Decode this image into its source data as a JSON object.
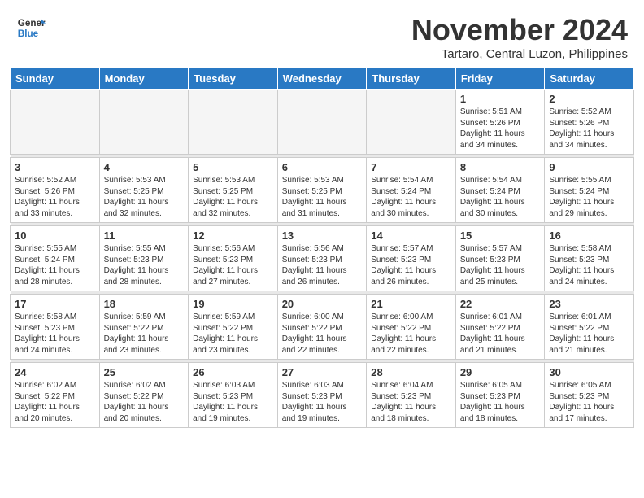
{
  "header": {
    "logo_general": "General",
    "logo_blue": "Blue",
    "month": "November 2024",
    "location": "Tartaro, Central Luzon, Philippines"
  },
  "days_of_week": [
    "Sunday",
    "Monday",
    "Tuesday",
    "Wednesday",
    "Thursday",
    "Friday",
    "Saturday"
  ],
  "weeks": [
    [
      {
        "day": "",
        "info": ""
      },
      {
        "day": "",
        "info": ""
      },
      {
        "day": "",
        "info": ""
      },
      {
        "day": "",
        "info": ""
      },
      {
        "day": "",
        "info": ""
      },
      {
        "day": "1",
        "info": "Sunrise: 5:51 AM\nSunset: 5:26 PM\nDaylight: 11 hours\nand 34 minutes."
      },
      {
        "day": "2",
        "info": "Sunrise: 5:52 AM\nSunset: 5:26 PM\nDaylight: 11 hours\nand 34 minutes."
      }
    ],
    [
      {
        "day": "3",
        "info": "Sunrise: 5:52 AM\nSunset: 5:26 PM\nDaylight: 11 hours\nand 33 minutes."
      },
      {
        "day": "4",
        "info": "Sunrise: 5:53 AM\nSunset: 5:25 PM\nDaylight: 11 hours\nand 32 minutes."
      },
      {
        "day": "5",
        "info": "Sunrise: 5:53 AM\nSunset: 5:25 PM\nDaylight: 11 hours\nand 32 minutes."
      },
      {
        "day": "6",
        "info": "Sunrise: 5:53 AM\nSunset: 5:25 PM\nDaylight: 11 hours\nand 31 minutes."
      },
      {
        "day": "7",
        "info": "Sunrise: 5:54 AM\nSunset: 5:24 PM\nDaylight: 11 hours\nand 30 minutes."
      },
      {
        "day": "8",
        "info": "Sunrise: 5:54 AM\nSunset: 5:24 PM\nDaylight: 11 hours\nand 30 minutes."
      },
      {
        "day": "9",
        "info": "Sunrise: 5:55 AM\nSunset: 5:24 PM\nDaylight: 11 hours\nand 29 minutes."
      }
    ],
    [
      {
        "day": "10",
        "info": "Sunrise: 5:55 AM\nSunset: 5:24 PM\nDaylight: 11 hours\nand 28 minutes."
      },
      {
        "day": "11",
        "info": "Sunrise: 5:55 AM\nSunset: 5:23 PM\nDaylight: 11 hours\nand 28 minutes."
      },
      {
        "day": "12",
        "info": "Sunrise: 5:56 AM\nSunset: 5:23 PM\nDaylight: 11 hours\nand 27 minutes."
      },
      {
        "day": "13",
        "info": "Sunrise: 5:56 AM\nSunset: 5:23 PM\nDaylight: 11 hours\nand 26 minutes."
      },
      {
        "day": "14",
        "info": "Sunrise: 5:57 AM\nSunset: 5:23 PM\nDaylight: 11 hours\nand 26 minutes."
      },
      {
        "day": "15",
        "info": "Sunrise: 5:57 AM\nSunset: 5:23 PM\nDaylight: 11 hours\nand 25 minutes."
      },
      {
        "day": "16",
        "info": "Sunrise: 5:58 AM\nSunset: 5:23 PM\nDaylight: 11 hours\nand 24 minutes."
      }
    ],
    [
      {
        "day": "17",
        "info": "Sunrise: 5:58 AM\nSunset: 5:23 PM\nDaylight: 11 hours\nand 24 minutes."
      },
      {
        "day": "18",
        "info": "Sunrise: 5:59 AM\nSunset: 5:22 PM\nDaylight: 11 hours\nand 23 minutes."
      },
      {
        "day": "19",
        "info": "Sunrise: 5:59 AM\nSunset: 5:22 PM\nDaylight: 11 hours\nand 23 minutes."
      },
      {
        "day": "20",
        "info": "Sunrise: 6:00 AM\nSunset: 5:22 PM\nDaylight: 11 hours\nand 22 minutes."
      },
      {
        "day": "21",
        "info": "Sunrise: 6:00 AM\nSunset: 5:22 PM\nDaylight: 11 hours\nand 22 minutes."
      },
      {
        "day": "22",
        "info": "Sunrise: 6:01 AM\nSunset: 5:22 PM\nDaylight: 11 hours\nand 21 minutes."
      },
      {
        "day": "23",
        "info": "Sunrise: 6:01 AM\nSunset: 5:22 PM\nDaylight: 11 hours\nand 21 minutes."
      }
    ],
    [
      {
        "day": "24",
        "info": "Sunrise: 6:02 AM\nSunset: 5:22 PM\nDaylight: 11 hours\nand 20 minutes."
      },
      {
        "day": "25",
        "info": "Sunrise: 6:02 AM\nSunset: 5:22 PM\nDaylight: 11 hours\nand 20 minutes."
      },
      {
        "day": "26",
        "info": "Sunrise: 6:03 AM\nSunset: 5:23 PM\nDaylight: 11 hours\nand 19 minutes."
      },
      {
        "day": "27",
        "info": "Sunrise: 6:03 AM\nSunset: 5:23 PM\nDaylight: 11 hours\nand 19 minutes."
      },
      {
        "day": "28",
        "info": "Sunrise: 6:04 AM\nSunset: 5:23 PM\nDaylight: 11 hours\nand 18 minutes."
      },
      {
        "day": "29",
        "info": "Sunrise: 6:05 AM\nSunset: 5:23 PM\nDaylight: 11 hours\nand 18 minutes."
      },
      {
        "day": "30",
        "info": "Sunrise: 6:05 AM\nSunset: 5:23 PM\nDaylight: 11 hours\nand 17 minutes."
      }
    ]
  ]
}
